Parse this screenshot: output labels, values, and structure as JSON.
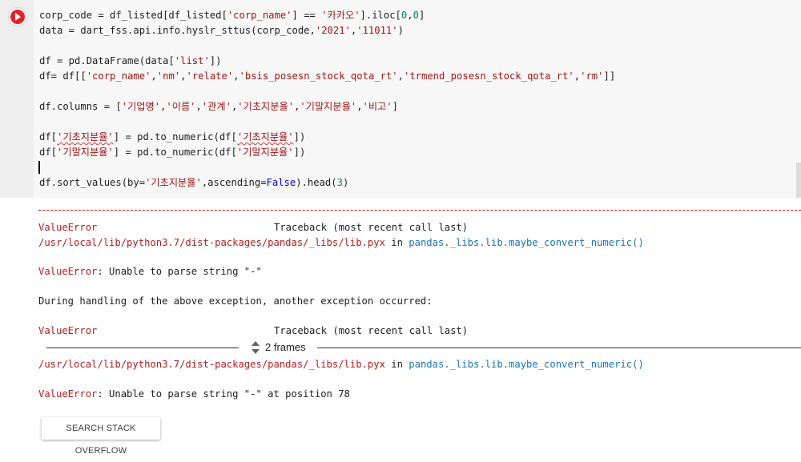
{
  "code_cell": {
    "lines": {
      "l1": {
        "a": "corp_code = df_listed[df_listed[",
        "b": "'corp_name'",
        "c": "] == ",
        "d": "'카카오'",
        "e": "].iloc[",
        "f": "0",
        "g": ",",
        "h": "0",
        "i": "]"
      },
      "l2": {
        "a": "data = dart_fss.api.info.hyslr_sttus(corp_code,",
        "b": "'2021'",
        "c": ",",
        "d": "'11011'",
        "e": ")"
      },
      "l3": {
        "a": "df = pd.DataFrame(data[",
        "b": "'list'",
        "c": "])"
      },
      "l4": {
        "a": "df= df[[",
        "b": "'corp_name'",
        "c": ",",
        "d": "'nm'",
        "e": ",",
        "f": "'relate'",
        "g": ",",
        "h": "'bsis_posesn_stock_qota_rt'",
        "i": ",",
        "j": "'trmend_posesn_stock_qota_rt'",
        "k": ",",
        "l": "'rm'",
        "m": "]]"
      },
      "l5": {
        "a": "df.columns = [",
        "b": "'기업명'",
        "c": ",",
        "d": "'이름'",
        "e": ",",
        "f": "'관계'",
        "g": ",",
        "h": "'기초지분율'",
        "i": ",",
        "j": "'기말지분율'",
        "k": ",",
        "l": "'비고'",
        "m": "]"
      },
      "l6": {
        "a": "df[",
        "b": "'기초지분율'",
        "c": "] = pd.to_numeric(df[",
        "d": "'기초지분율'",
        "e": "])"
      },
      "l7": {
        "a": "df[",
        "b": "'기말지분율'",
        "c": "] = pd.to_numeric(df[",
        "d": "'기말지분율'",
        "e": "])"
      },
      "l8": {
        "a": "df.sort_values(by=",
        "b": "'기초지분율'",
        "c": ",ascending=",
        "d": "False",
        "e": ").head(",
        "f": "3",
        "g": ")"
      }
    }
  },
  "output": {
    "tb1_name": "ValueError",
    "tb1_right": "Traceback (most recent call last)",
    "file1_path": "/usr/local/lib/python3.7/dist-packages/pandas/_libs/lib.pyx",
    "file1_in": " in ",
    "file1_func": "pandas._libs.lib.maybe_convert_numeric()",
    "err1_name": "ValueError",
    "err1_msg": ": Unable to parse string \"-\"",
    "during": "During handling of the above exception, another exception occurred:",
    "tb2_name": "ValueError",
    "tb2_right": "Traceback (most recent call last)",
    "frames_label": "2 frames",
    "file2_path": "/usr/local/lib/python3.7/dist-packages/pandas/_libs/lib.pyx",
    "file2_in": " in ",
    "file2_func": "pandas._libs.lib.maybe_convert_numeric()",
    "err2_name": "ValueError",
    "err2_msg": ": Unable to parse string \"-\" at position 78"
  },
  "buttons": {
    "search_stack_overflow": "SEARCH STACK OVERFLOW"
  },
  "colors": {
    "run_button": "#e0242a",
    "string": "#a31515",
    "number": "#098658",
    "keyword": "#0000ff",
    "error": "#b71c1c",
    "link": "#1a73b8"
  },
  "icons": {
    "run": "play-circle-icon",
    "frames_toggle": "chevron-updown-icon"
  }
}
